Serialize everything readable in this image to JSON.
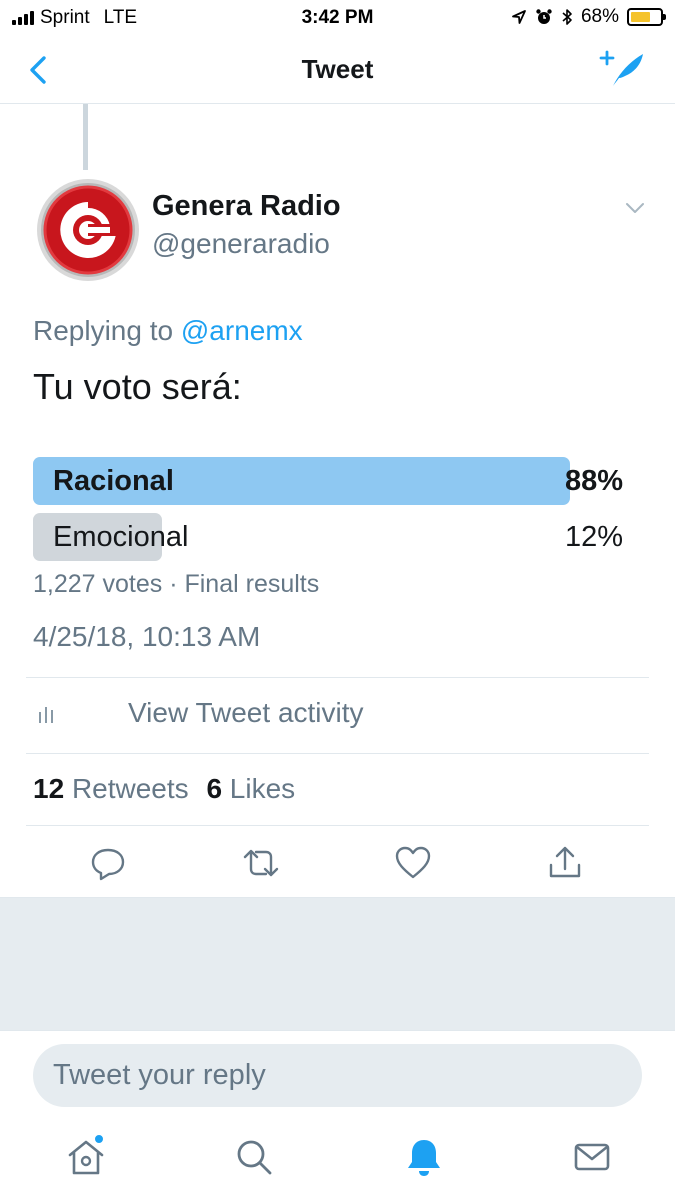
{
  "status_bar": {
    "carrier": "Sprint",
    "network": "LTE",
    "time": "3:42 PM",
    "battery_percent": "68%",
    "battery_level": 0.68,
    "battery_color": "#f5c32c"
  },
  "nav": {
    "title": "Tweet",
    "back_icon": "chevron-left-icon",
    "compose_icon": "compose-feather-icon"
  },
  "tweet": {
    "display_name": "Genera Radio",
    "handle": "@generaradio",
    "replying_prefix": "Replying to",
    "replying_to": "@arnemx",
    "text": "Tu voto será:",
    "timestamp": "4/25/18, 10:13 AM"
  },
  "poll": {
    "options": [
      {
        "label": "Racional",
        "percent_text": "88%",
        "percent": 88,
        "winner": true,
        "color": "#8ec8f2"
      },
      {
        "label": "Emocional",
        "percent_text": "12%",
        "percent": 12,
        "winner": false,
        "color": "#d0d6db"
      }
    ],
    "votes": "1,227 votes",
    "separator": " · ",
    "status": "Final results"
  },
  "activity": {
    "label": "View Tweet activity",
    "icon": "bar-chart-icon"
  },
  "stats": {
    "retweets_count": "12",
    "retweets_label": "Retweets",
    "likes_count": "6",
    "likes_label": "Likes"
  },
  "actions": [
    "reply-icon",
    "retweet-icon",
    "like-icon",
    "share-icon"
  ],
  "reply": {
    "placeholder": "Tweet your reply"
  },
  "tabs": [
    {
      "icon": "home-icon",
      "active": false,
      "badge": true
    },
    {
      "icon": "search-icon",
      "active": false,
      "badge": false
    },
    {
      "icon": "notifications-icon",
      "active": true,
      "badge": false
    },
    {
      "icon": "messages-icon",
      "active": false,
      "badge": false
    }
  ],
  "colors": {
    "accent": "#1da1f2",
    "text_primary": "#14171a",
    "text_secondary": "#657786",
    "divider": "#e1e8ed",
    "background_gray": "#e6ecf0"
  }
}
